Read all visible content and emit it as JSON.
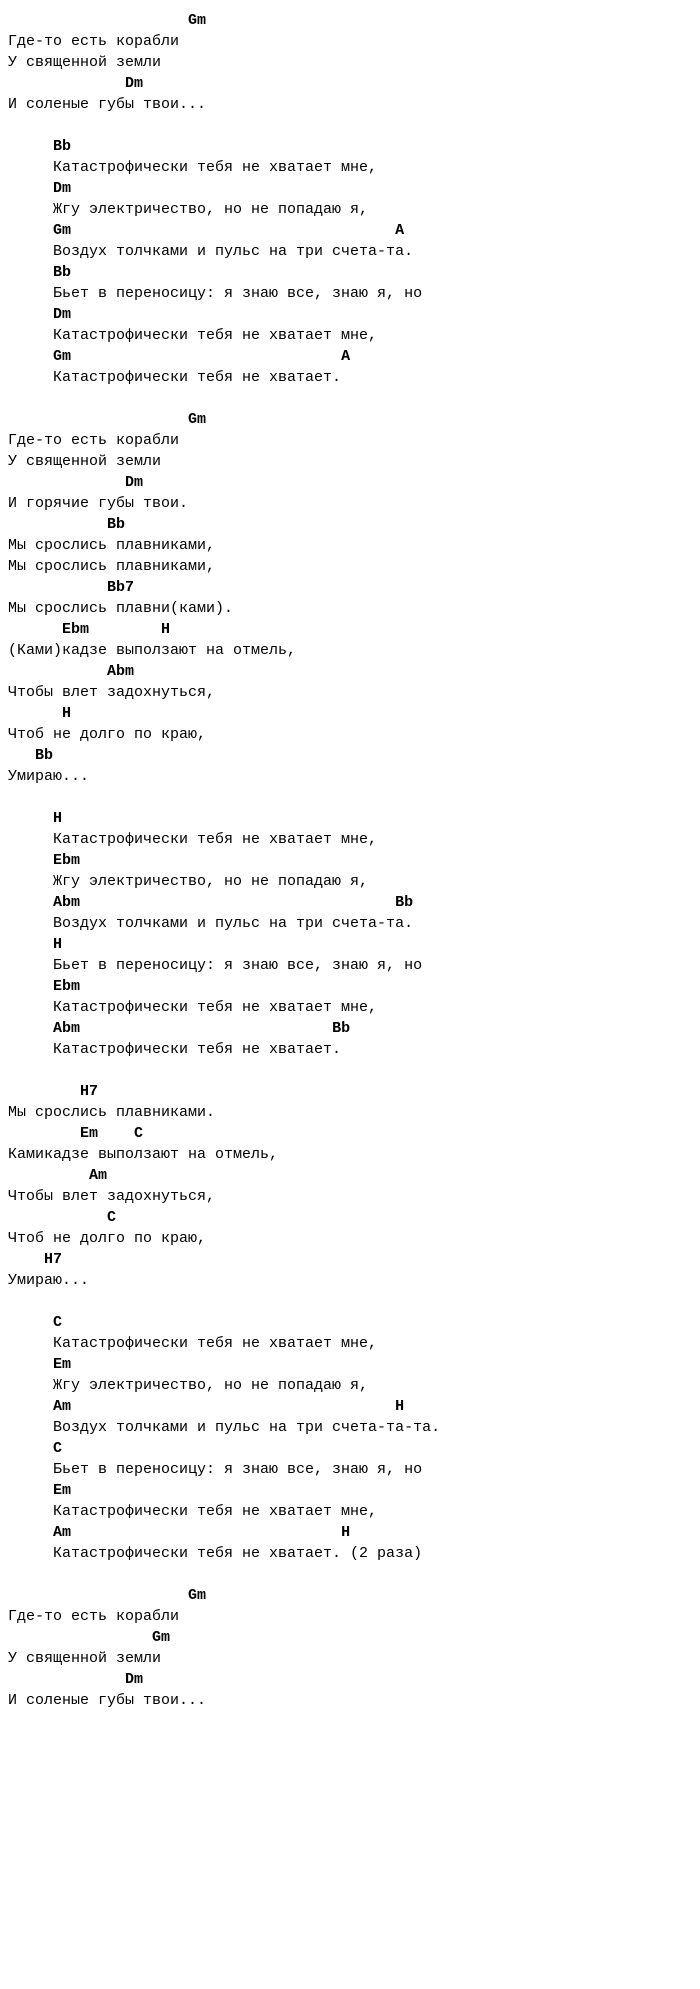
{
  "lines": [
    {
      "t": "                    <b>Gm</b>"
    },
    {
      "t": "Где-то есть корабли"
    },
    {
      "t": "У священной земли"
    },
    {
      "t": "             <b>Dm</b>"
    },
    {
      "t": "И соленые губы твои..."
    },
    {
      "t": ""
    },
    {
      "t": "     <b>Bb</b>"
    },
    {
      "t": "     Катастрофически тебя не хватает мне,"
    },
    {
      "t": "     <b>Dm</b>"
    },
    {
      "t": "     Жгу электричество, но не попадаю я,"
    },
    {
      "t": "     <b>Gm</b>                                    <b>A</b>"
    },
    {
      "t": "     Воздух толчками и пульс на три счета-та."
    },
    {
      "t": "     <b>Bb</b>"
    },
    {
      "t": "     Бьет в переносицу: я знаю все, знаю я, но"
    },
    {
      "t": "     <b>Dm</b>"
    },
    {
      "t": "     Катастрофически тебя не хватает мне,"
    },
    {
      "t": "     <b>Gm</b>                              <b>A</b>"
    },
    {
      "t": "     Катастрофически тебя не хватает."
    },
    {
      "t": ""
    },
    {
      "t": "                    <b>Gm</b>"
    },
    {
      "t": "Где-то есть корабли"
    },
    {
      "t": "У священной земли"
    },
    {
      "t": "             <b>Dm</b>"
    },
    {
      "t": "И горячие губы твои."
    },
    {
      "t": "           <b>Bb</b>"
    },
    {
      "t": "Мы срослись плавниками,"
    },
    {
      "t": "Мы срослись плавниками,"
    },
    {
      "t": "           <b>Bb7</b>"
    },
    {
      "t": "Мы срослись плавни(ками)."
    },
    {
      "t": "      <b>Ebm</b>        <b>H</b>"
    },
    {
      "t": "(Ками)кадзе выползают на отмель,"
    },
    {
      "t": "           <b>Abm</b>"
    },
    {
      "t": "Чтобы влет задохнуться,"
    },
    {
      "t": "      <b>H</b>"
    },
    {
      "t": "Чтоб не долго по краю,"
    },
    {
      "t": "   <b>Bb</b>"
    },
    {
      "t": "Умираю..."
    },
    {
      "t": ""
    },
    {
      "t": "     <b>H</b>"
    },
    {
      "t": "     Катастрофически тебя не хватает мне,"
    },
    {
      "t": "     <b>Ebm</b>"
    },
    {
      "t": "     Жгу электричество, но не попадаю я,"
    },
    {
      "t": "     <b>Abm</b>                                   <b>Bb</b>"
    },
    {
      "t": "     Воздух толчками и пульс на три счета-та."
    },
    {
      "t": "     <b>H</b>"
    },
    {
      "t": "     Бьет в переносицу: я знаю все, знаю я, но"
    },
    {
      "t": "     <b>Ebm</b>"
    },
    {
      "t": "     Катастрофически тебя не хватает мне,"
    },
    {
      "t": "     <b>Abm</b>                            <b>Bb</b>"
    },
    {
      "t": "     Катастрофически тебя не хватает."
    },
    {
      "t": ""
    },
    {
      "t": "        <b>H7</b>"
    },
    {
      "t": "Мы срослись плавниками."
    },
    {
      "t": "        <b>Em</b>    <b>C</b>"
    },
    {
      "t": "Камикадзе выползают на отмель,"
    },
    {
      "t": "         <b>Am</b>"
    },
    {
      "t": "Чтобы влет задохнуться,"
    },
    {
      "t": "           <b>C</b>"
    },
    {
      "t": "Чтоб не долго по краю,"
    },
    {
      "t": "    <b>H7</b>"
    },
    {
      "t": "Умираю..."
    },
    {
      "t": ""
    },
    {
      "t": "     <b>C</b>"
    },
    {
      "t": "     Катастрофически тебя не хватает мне,"
    },
    {
      "t": "     <b>Em</b>"
    },
    {
      "t": "     Жгу электричество, но не попадаю я,"
    },
    {
      "t": "     <b>Am</b>                                    <b>H</b>"
    },
    {
      "t": "     Воздух толчками и пульс на три счета-та-та."
    },
    {
      "t": "     <b>C</b>"
    },
    {
      "t": "     Бьет в переносицу: я знаю все, знаю я, но"
    },
    {
      "t": "     <b>Em</b>"
    },
    {
      "t": "     Катастрофически тебя не хватает мне,"
    },
    {
      "t": "     <b>Am</b>                              <b>H</b>"
    },
    {
      "t": "     Катастрофически тебя не хватает. (2 раза)"
    },
    {
      "t": ""
    },
    {
      "t": "                    <b>Gm</b>"
    },
    {
      "t": "Где-то есть корабли"
    },
    {
      "t": "                <b>Gm</b>"
    },
    {
      "t": "У священной земли"
    },
    {
      "t": "             <b>Dm</b>"
    },
    {
      "t": "И соленые губы твои..."
    }
  ]
}
